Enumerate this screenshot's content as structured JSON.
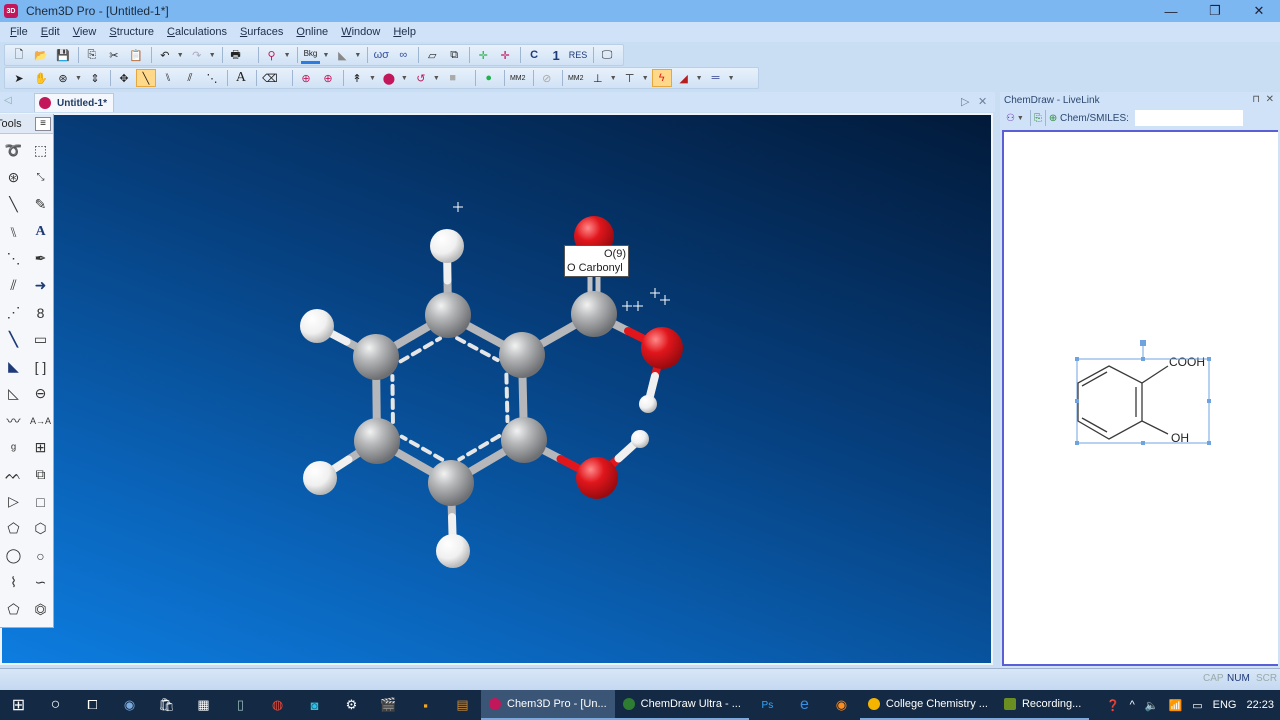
{
  "window": {
    "title": "Chem3D Pro - [Untitled-1*]",
    "app_icon_label": "3D",
    "minimize": "—",
    "restore": "❐",
    "close": "✕"
  },
  "menu": [
    "File",
    "Edit",
    "View",
    "Structure",
    "Calculations",
    "Surfaces",
    "Online",
    "Window",
    "Help"
  ],
  "toolbar1": {
    "buttons": [
      "new",
      "open",
      "save",
      "copy",
      "cut",
      "paste",
      "undo",
      "redo",
      "print",
      "bond-tool",
      "background",
      "color",
      "stereo-glasses",
      "stereo-view",
      "box",
      "perspective",
      "move-x",
      "move-y",
      "C",
      "1",
      "RES",
      "fullscreen"
    ],
    "labels": {
      "c": "C",
      "one": "1",
      "res": "RES",
      "bkg": "Bkg"
    }
  },
  "toolbar2": {
    "labels": {
      "a": "A",
      "mm2": "MM2",
      "mm2b": "MM2"
    }
  },
  "document": {
    "tab_label": "Untitled-1*",
    "scroll_left": "◁",
    "tab_next": "▷",
    "tab_close": "✕"
  },
  "tools_panel": {
    "title": "Tools",
    "menu_glyph": "≡",
    "tools": [
      "lasso-select",
      "rect-select",
      "rotate",
      "mm-measure",
      "single-bond",
      "eraser",
      "double-bond",
      "text",
      "dashed-bond",
      "lasso-pen",
      "hashed-bond",
      "arrow",
      "dotted-bond",
      "orbital",
      "bold-bond",
      "rectangle",
      "wedge-bond",
      "brackets",
      "hash-wedge",
      "charge",
      "wavy-bond",
      "reaction-mapping",
      "chain",
      "grid",
      "polymer",
      "template",
      "triangle",
      "square",
      "pentagon",
      "hexagon",
      "heptagon",
      "octagon",
      "cyclohexane-chair-1",
      "cyclohexane-chair-2",
      "cyclopentadiene",
      "benzene"
    ],
    "glyphs": {
      "text": "A",
      "charge": "⊖",
      "map": "A→A",
      "arrow": "➜"
    }
  },
  "model": {
    "molecule": "salicylic acid",
    "tooltip": {
      "line1": "O(9)",
      "line2": "O Carbonyl"
    },
    "atom_colors": {
      "carbon": "#9ea0a3",
      "oxygen": "#e0161c",
      "hydrogen": "#f2f2f2"
    }
  },
  "livelink": {
    "title": "ChemDraw - LiveLink",
    "pin": "⊓",
    "close": "✕",
    "smiles_label": "Chem/SMILES:",
    "smiles_value": "",
    "structure": {
      "substituent_top": "COOH",
      "substituent_bottom": "OH"
    }
  },
  "statusbar": {
    "indicators": [
      "CAP",
      "NUM",
      "SCR"
    ]
  },
  "taskbar": {
    "apps": [
      {
        "label": "Chem3D Pro - [Un...",
        "color": "#c2185b",
        "active": true
      },
      {
        "label": "ChemDraw Ultra - ...",
        "color": "#2e7d32",
        "active": false
      },
      {
        "label": "College Chemistry ...",
        "color": "#f4b400",
        "active": false
      },
      {
        "label": "Recording...",
        "color": "#6b8e23",
        "active": false
      }
    ],
    "language": "ENG",
    "time": "22:23"
  }
}
